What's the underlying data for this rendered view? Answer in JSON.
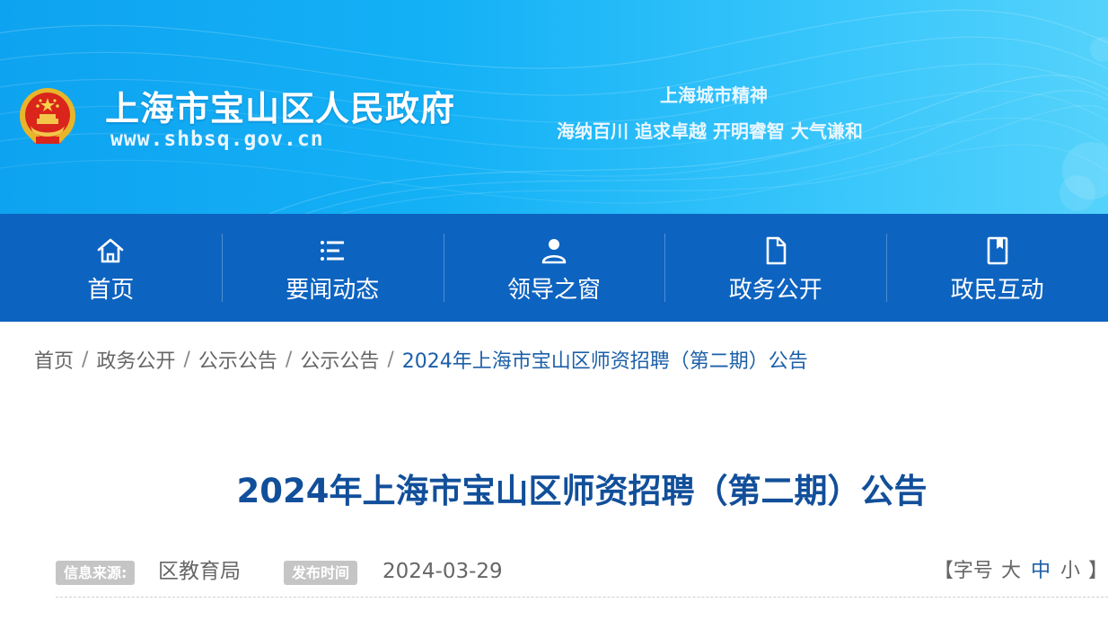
{
  "header": {
    "site_name": "上海市宝山区人民政府",
    "site_url": "www.shbsq.gov.cn",
    "spirit_title": "上海城市精神",
    "spirit_text": "海纳百川 追求卓越 开明睿智 大气谦和",
    "emblem_icon": "national-emblem-icon"
  },
  "nav": {
    "items": [
      {
        "label": "首页",
        "icon": "home-icon"
      },
      {
        "label": "要闻动态",
        "icon": "list-icon"
      },
      {
        "label": "领导之窗",
        "icon": "person-icon"
      },
      {
        "label": "政务公开",
        "icon": "document-icon"
      },
      {
        "label": "政民互动",
        "icon": "book-icon"
      }
    ]
  },
  "breadcrumb": {
    "items": [
      "首页",
      "政务公开",
      "公示公告",
      "公示公告",
      "2024年上海市宝山区师资招聘（第二期）公告"
    ],
    "separator": "/"
  },
  "article": {
    "title": "2024年上海市宝山区师资招聘（第二期）公告",
    "source_label": "信息来源:",
    "source_value": "区教育局",
    "date_label": "发布时间",
    "date_value": "2024-03-29",
    "font_size_prefix": "【字号",
    "font_size_large": "大",
    "font_size_medium": "中",
    "font_size_small": "小",
    "font_size_suffix": "】"
  },
  "colors": {
    "banner": "#14b1f6",
    "nav": "#0d63c0",
    "title": "#124f9a",
    "link": "#1c5fa8"
  }
}
